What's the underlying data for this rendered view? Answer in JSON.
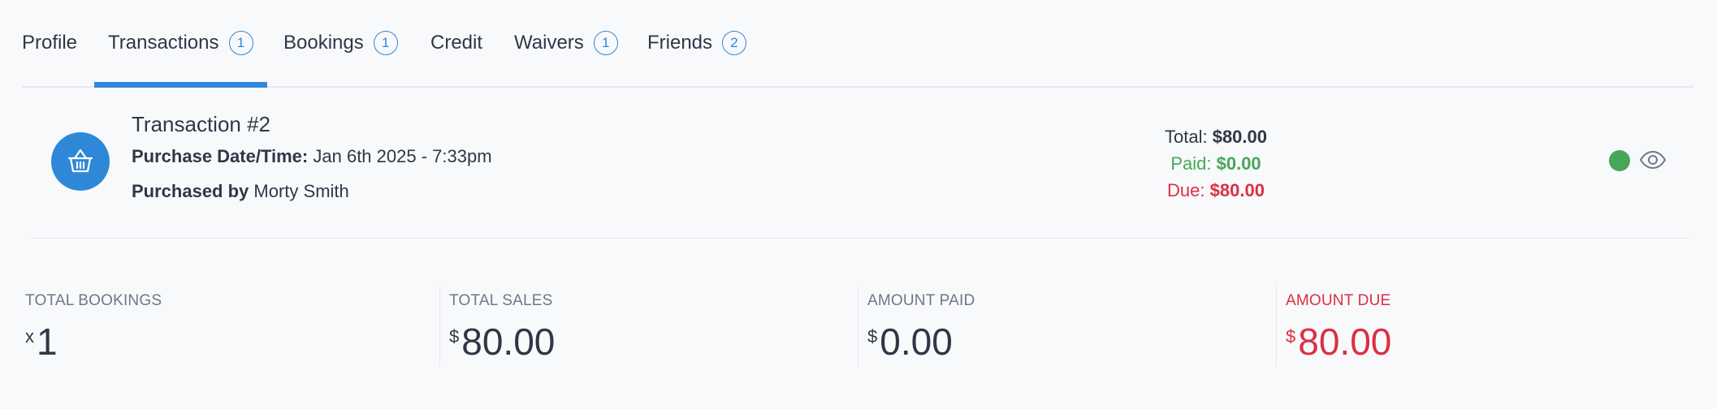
{
  "tabs": [
    {
      "label": "Profile",
      "badge": ""
    },
    {
      "label": "Transactions",
      "badge": "1"
    },
    {
      "label": "Bookings",
      "badge": "1"
    },
    {
      "label": "Credit",
      "badge": ""
    },
    {
      "label": "Waivers",
      "badge": "1"
    },
    {
      "label": "Friends",
      "badge": "2"
    }
  ],
  "active_tab": "Transactions",
  "transaction": {
    "title": "Transaction #2",
    "date_label": "Purchase Date/Time:",
    "date_value": "Jan 6th 2025 - 7:33pm",
    "by_label": "Purchased by",
    "by_value": "Morty Smith",
    "icon": "basket-icon",
    "total_label": "Total:",
    "total_value": "$80.00",
    "paid_label": "Paid:",
    "paid_value": "$0.00",
    "due_label": "Due:",
    "due_value": "$80.00",
    "status_color": "#46a659"
  },
  "stats": {
    "bookings": {
      "label": "TOTAL BOOKINGS",
      "prefix": "x",
      "value": "1"
    },
    "sales": {
      "label": "TOTAL SALES",
      "prefix": "$",
      "value": "80.00"
    },
    "paid": {
      "label": "AMOUNT PAID",
      "prefix": "$",
      "value": "0.00"
    },
    "due": {
      "label": "AMOUNT DUE",
      "prefix": "$",
      "value": "80.00"
    }
  },
  "colors": {
    "accent": "#2f87d8",
    "paid": "#46a659",
    "due": "#dc2f43",
    "text": "#2f3747"
  }
}
